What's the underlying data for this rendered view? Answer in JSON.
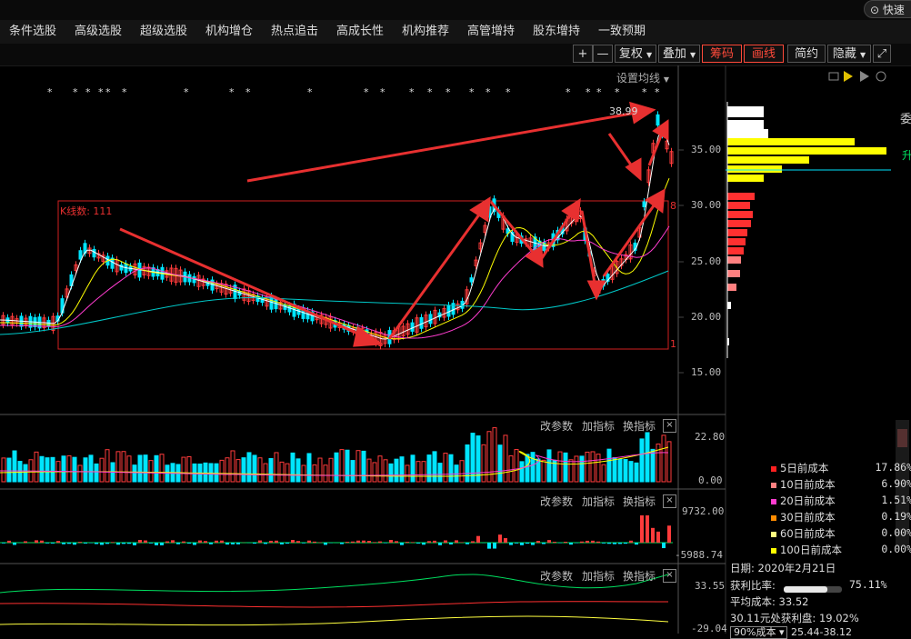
{
  "quick_button": "快速",
  "menu": [
    "条件选股",
    "高级选股",
    "超级选股",
    "机构增仓",
    "热点追击",
    "高成长性",
    "机构推荐",
    "高管增持",
    "股东增持",
    "一致预期"
  ],
  "toolbar": {
    "plus": "+",
    "minus": "—",
    "fuquan": "复权",
    "diejia": "叠加",
    "chouma": "筹码",
    "huaxian": "画线",
    "jianyue": "简约",
    "yincang": "隐藏"
  },
  "main_chart": {
    "ma_setting": "设置均线",
    "peak_label": "38.99",
    "box_label": "K线数: 111",
    "box_right_top": "8",
    "box_right_bottom": "1",
    "price_axis": [
      "35.00",
      "30.00",
      "25.00",
      "20.00",
      "15.00"
    ]
  },
  "volume_panel": {
    "modify": "改参数",
    "add": "加指标",
    "switch": "换指标",
    "close": "×",
    "axis_top": "22.80",
    "axis_bottom": "0.00"
  },
  "macd_panel": {
    "modify": "改参数",
    "add": "加指标",
    "switch": "换指标",
    "close": "×",
    "axis_top": "9732.00",
    "axis_bottom": "-5988.74"
  },
  "third_panel": {
    "modify": "改参数",
    "add": "加指标",
    "switch": "换指标",
    "close": "×",
    "axis_top": "33.55",
    "axis_bottom": "-29.04"
  },
  "cost_legend": [
    {
      "label": "5日前成本",
      "pct": "17.86%",
      "color": "#ff2020"
    },
    {
      "label": "10日前成本",
      "pct": "6.90%",
      "color": "#ff8080"
    },
    {
      "label": "20日前成本",
      "pct": "1.51%",
      "color": "#ff3ccf"
    },
    {
      "label": "30日前成本",
      "pct": "0.19%",
      "color": "#ff8c00"
    },
    {
      "label": "60日前成本",
      "pct": "0.00%",
      "color": "#ffff80"
    },
    {
      "label": "100日前成本",
      "pct": "0.00%",
      "color": "#ffff00"
    }
  ],
  "chip_info": {
    "date": "日期: 2020年2月21日",
    "profit_label": "获利比率:",
    "profit_value": "75.11%",
    "profit_fraction": 0.7511,
    "avg_cost": "平均成本: 33.52",
    "profit_at": "30.11元处获利盘: 19.02%",
    "range_select": "90%成本",
    "range_value": "25.44-38.12"
  },
  "right_edge": [
    "委",
    "升"
  ],
  "colors": {
    "up": "#ff3b3b",
    "down": "#00e5ff",
    "ma5": "#ffffff",
    "ma10": "#ffff00",
    "ma20": "#ff3ccf",
    "ma60": "#00c8c8",
    "annotation": "#e83030"
  }
}
